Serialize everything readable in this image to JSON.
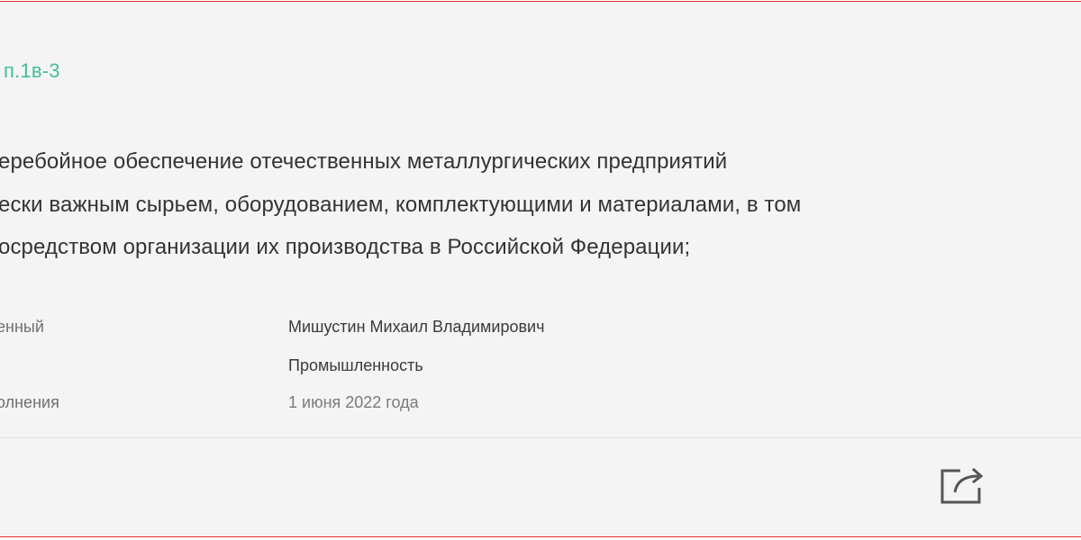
{
  "item": {
    "code": "п.1в-3",
    "description_lines": [
      "еребойное обеспечение отечественных металлургических предприятий",
      "ески важным сырьем, оборудованием, комплектующими и материалами, в том",
      "осредством организации их производства в Российской Федерации;"
    ],
    "details": [
      {
        "label": "енный",
        "value": "Мишустин Михаил Владимирович"
      },
      {
        "label": "",
        "value": "Промышленность"
      },
      {
        "label": "олнения",
        "value": "1 июня 2022 года"
      }
    ]
  },
  "actions": {
    "share_icon": "share-icon"
  },
  "colors": {
    "accent": "#3fbf9c",
    "border": "#e22b2b",
    "background": "#f4f4f4"
  }
}
